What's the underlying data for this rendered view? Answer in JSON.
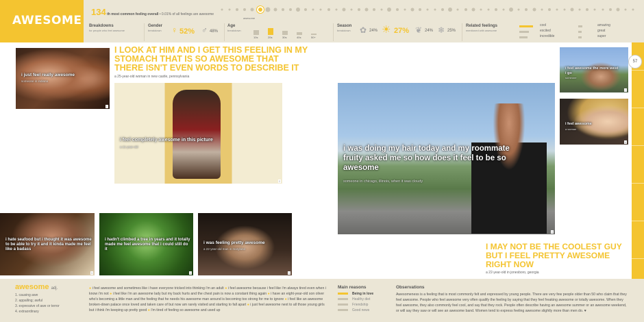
{
  "header": {
    "title": "AWESOME",
    "rank_number": "134",
    "rank_label": "th most common feeling overall",
    "rank_share": "• 0.01% of all feelings are awesome",
    "dot_label": "awesome",
    "breakdowns": {
      "title": "Breakdowns",
      "sub": "for people who feel awesome"
    },
    "gender": {
      "title": "Gender",
      "sub": "breakdown",
      "female_pct": "52%",
      "male_pct": "48%"
    },
    "age": {
      "title": "Age",
      "sub": "breakdown",
      "groups": [
        "10s",
        "20s",
        "30s",
        "40s",
        "50+"
      ],
      "levels": [
        0.55,
        0.85,
        0.5,
        0.3,
        0.2
      ]
    },
    "season": {
      "title": "Season",
      "sub": "breakdown",
      "spring_pct": "24%",
      "summer_pct": "27%",
      "fall_pct": "24%",
      "winter_pct": "25%"
    },
    "related": {
      "title": "Related feelings",
      "sub": "mentioned with awesome",
      "items": [
        "cool",
        "excited",
        "incredible",
        "amazing",
        "great",
        "super"
      ]
    },
    "colors": {
      "accent": "#f4c430",
      "panel": "#ebe6d6",
      "muted": "#c8c2b0"
    }
  },
  "page_number": "57",
  "photos": {
    "p1": {
      "caption": "i just feel really awesome",
      "sub": "someone in indiana",
      "num": "1"
    },
    "p2": {
      "caption": "i feel completely awesome in this picture",
      "sub": "a 21-year-old",
      "num": "2"
    },
    "p3": {
      "caption": "i hate seafood but i thought it was awesome to be able to try it and it kinda made me feel like a badass",
      "num": "3"
    },
    "p4": {
      "caption": "i hadn't climbed a tree in years and it totally made me feel awesome that i could still do it",
      "num": "4"
    },
    "p5": {
      "caption": "i was feeling pretty awesome",
      "sub": "a 22-year-old man in maryland",
      "num": "5"
    },
    "p6": {
      "caption": "i was doing my hair today and my roommate fruity asked me so how does it feel to be so awesome",
      "sub": "someone in chicago, illinois, when it was cloudy",
      "num": "6"
    },
    "p7": {
      "caption": "i feel awesome the more west i go",
      "sub": "someone",
      "num": "7"
    },
    "p8": {
      "caption": "i feel awesome",
      "sub": "a woman",
      "num": "8"
    }
  },
  "headlines": {
    "h1": {
      "text": "I LOOK AT HIM AND I GET THIS FEELING IN MY STOMACH THAT IS SO AWESOME THAT THERE ISN'T EVEN WORDS TO DESCRIBE IT",
      "byline": "a 25-year-old woman in new castle, pennsylvania"
    },
    "h2": {
      "text": "I MAY NOT BE THE COOLEST GUY BUT I FEEL PRETTY AWESOME RIGHT NOW",
      "byline": "a 22-year-old in jonesboro, georgia"
    }
  },
  "definition": {
    "word": "awesome",
    "pos": "adj.",
    "senses": [
      "1. causing awe",
      "2. appalling; awful",
      "3. expressive of awe or terror",
      "4. extraordinary"
    ]
  },
  "quotes": [
    "i feel awesome and sometimes like i have everyone tricked into thinking i'm an adult",
    "i feel awesome because i feel like i'm always tired even when i know i'm not",
    "i feel like i'm an awesome lady but my back hurts and the chest pain is now a constant thing again",
    "i have an eight-year-old son oliver who's becoming a little man and the feeling that he needs his awesome man around is becoming too strong for me to ignore",
    "i feel like an awesome broken-down palace once loved and taken care of but now am rarely visited and starting to fall apart",
    "i just feel awesome next to all those young girls but i think i'm keeping up pretty good",
    "i'm tired of feeling so awesome and used up"
  ],
  "reasons": {
    "title": "Main reasons",
    "items": [
      "Being in love",
      "Healthy diet",
      "Friendship",
      "Good news"
    ]
  },
  "observations": {
    "title": "Observations",
    "text": "Awesomeness is a feeling that is most commonly felt and expressed by young people. There are very few people older than 50 who claim that they feel awesome. People who feel awesome very often qualify the feeling by saying that they feel freaking awesome or totally awesome. When they feel awesome, they also commonly feel cool, and say that they rock. People often describe having an awesome summer or an awesome weekend, or will say they saw or will see an awesome band. Women tend to express feeling awesome slightly more than men do. ♥"
  }
}
